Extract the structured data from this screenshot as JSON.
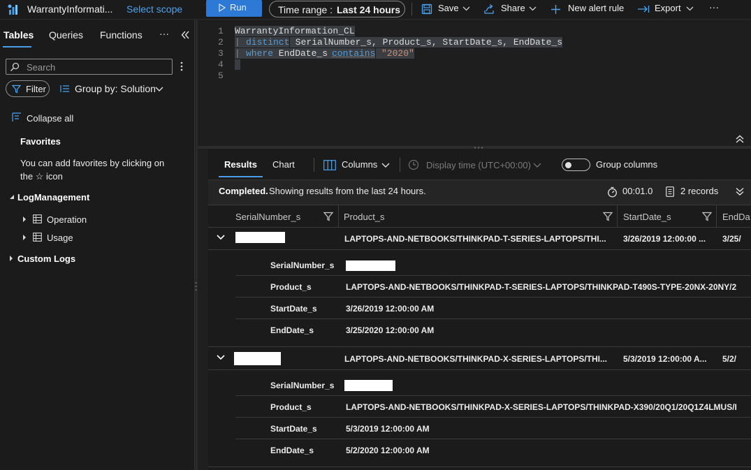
{
  "toolbar": {
    "workspace": "WarrantyInformati...",
    "select_scope": "Select scope",
    "run_label": "Run",
    "time_range_label": "Time range :",
    "time_range_value": "Last 24 hours",
    "save_label": "Save",
    "share_label": "Share",
    "new_alert_label": "New alert rule",
    "export_label": "Export",
    "more": "···"
  },
  "sidebar": {
    "tabs": [
      "Tables",
      "Queries",
      "Functions"
    ],
    "more": "···",
    "search_placeholder": "Search",
    "filter_label": "Filter",
    "group_by_label": "Group by: Solution",
    "collapse_all": "Collapse all",
    "favorites_title": "Favorites",
    "favorites_text_1": "You can add favorites by clicking on",
    "favorites_text_2": "the ☆ icon",
    "log_management": "LogManagement",
    "items": [
      "Operation",
      "Usage"
    ],
    "custom_logs": "Custom Logs"
  },
  "editor": {
    "line_numbers": [
      "1",
      "2",
      "3",
      "4",
      "5"
    ],
    "line1": "WarrantyInformation_CL",
    "line2_kw": "distinct",
    "line2_rest": " SerialNumber_s, Product_s, StartDate_s, EndDate_s",
    "line3_kw": "where",
    "line3_mid": " EndDate_s ",
    "line3_op": "contains",
    "line3_str": "\"2020\""
  },
  "results": {
    "tab_results": "Results",
    "tab_chart": "Chart",
    "columns_label": "Columns",
    "display_time": "Display time (UTC+00:00)",
    "group_columns": "Group columns",
    "status_bold": "Completed.",
    "status_text": " Showing results from the last 24 hours.",
    "duration": "00:01.0",
    "records": "2 records",
    "headers": [
      "SerialNumber_s",
      "Product_s",
      "StartDate_s",
      "EndDa"
    ],
    "rows": [
      {
        "product_short": "LAPTOPS-AND-NETBOOKS/THINKPAD-T-SERIES-LAPTOPS/THI...",
        "start_short": "3/26/2019 12:00:00 ...",
        "end_short": "3/25/",
        "fields": [
          {
            "k": "SerialNumber_s",
            "v": ""
          },
          {
            "k": "Product_s",
            "v": "LAPTOPS-AND-NETBOOKS/THINKPAD-T-SERIES-LAPTOPS/THINKPAD-T490S-TYPE-20NX-20NY/2"
          },
          {
            "k": "StartDate_s",
            "v": "3/26/2019 12:00:00 AM"
          },
          {
            "k": "EndDate_s",
            "v": "3/25/2020 12:00:00 AM"
          }
        ]
      },
      {
        "product_short": "LAPTOPS-AND-NETBOOKS/THINKPAD-X-SERIES-LAPTOPS/THI...",
        "start_short": "5/3/2019 12:00:00 A...",
        "end_short": "5/2/",
        "fields": [
          {
            "k": "SerialNumber_s",
            "v": ""
          },
          {
            "k": "Product_s",
            "v": "LAPTOPS-AND-NETBOOKS/THINKPAD-X-SERIES-LAPTOPS/THINKPAD-X390/20Q1/20Q1Z4LMUS/I"
          },
          {
            "k": "StartDate_s",
            "v": "5/3/2019 12:00:00 AM"
          },
          {
            "k": "EndDate_s",
            "v": "5/2/2020 12:00:00 AM"
          }
        ]
      }
    ]
  }
}
